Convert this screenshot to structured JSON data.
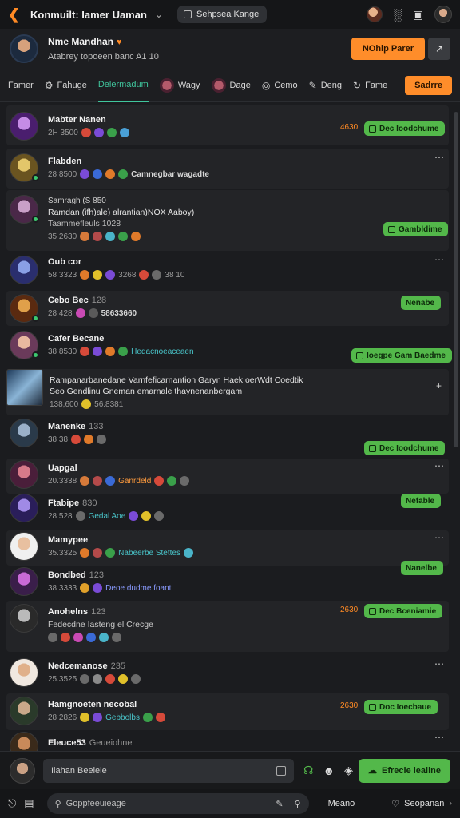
{
  "topbar": {
    "title": "Konmuilt: Iamer Uaman",
    "chevron": "chevron-down-icon",
    "workspace_pill": "Sehpsea Kange",
    "icons": [
      "user-avatar-mini",
      "stats-icon",
      "camera-icon",
      "profile-avatar"
    ]
  },
  "profile": {
    "name": "Nme Mandhan",
    "subtitle": "Atabrey topoeen banc  A1 10",
    "cta": "NOhip Parer",
    "ext_icon": "external-link-icon"
  },
  "tabs": [
    {
      "label": "Famer",
      "icon": ""
    },
    {
      "label": "Fahuge",
      "icon": "gear-icon"
    },
    {
      "label": "Delermadum",
      "icon": "",
      "active": true
    },
    {
      "label": "Wagy",
      "icon": "avatar"
    },
    {
      "label": "Dage",
      "icon": "avatar"
    },
    {
      "label": "Cemo",
      "icon": "compass-icon"
    },
    {
      "label": "Deng",
      "icon": "pen-icon"
    },
    {
      "label": "Fame",
      "icon": "refresh-icon"
    }
  ],
  "tabs_cta": "Sadrre",
  "feed": {
    "items": [
      {
        "name": "Mabter Nanen",
        "meta": "2H 3500",
        "tags": [],
        "price": "4630",
        "button": "Dec Ioodchume",
        "more": false
      },
      {
        "name": "Flabden",
        "meta": "28 8500",
        "tags": [
          "Camnegbar wagadte"
        ],
        "price": "",
        "button": "",
        "more": true
      },
      {
        "name": "Samragh (S 850",
        "line2": "Ramdan (ifh)ale) alrantian)NOX Aaboy)",
        "line3": "Taammefleuls 1028",
        "meta": "35 2630",
        "tags": [],
        "price": "",
        "button": "Gambldime",
        "more": false
      },
      {
        "name": "Oub cor",
        "meta": "58 3323",
        "tags": [
          "3268",
          "38  10"
        ],
        "price": "",
        "button": "",
        "more": true
      },
      {
        "name": "Cebo Bec",
        "muted": "128",
        "meta": "28 428",
        "tags": [
          "58633660"
        ],
        "price": "",
        "button": "Nenabe",
        "more": false
      },
      {
        "name": "Cafer Becane",
        "meta": "38 8530",
        "tags": [
          "Hedacnoeaceaen"
        ],
        "price": "",
        "button": "Ioegpe Gam Baedme",
        "more": false
      },
      {
        "name": "Rampanarbanedane Varnfeficarnantion Garyn Haek oerWdt Coedtik",
        "line2": "Seo Gendlinu Gneman emarnale thaynenanbergam",
        "meta": "138,600",
        "tags": [
          "56.8381"
        ],
        "price": "",
        "button": "",
        "more": false,
        "plus": true
      },
      {
        "name": "Manenke",
        "muted": "133",
        "meta": "38 38",
        "tags": [],
        "price": "",
        "button": "Dec Ioodchume",
        "more": false
      },
      {
        "name": "Uapgal",
        "meta": "20.3338",
        "tags": [
          "Ganrdeld"
        ],
        "price": "",
        "button": "",
        "more": true
      },
      {
        "name": "Ftabipe",
        "muted": "830",
        "meta": "28 528",
        "tags": [
          "Gedal Aoe"
        ],
        "price": "",
        "button": "Nefable",
        "more": false
      },
      {
        "name": "Mamypee",
        "meta": "35.3325",
        "tags": [
          "Nabeerbe Stettes"
        ],
        "price": "",
        "button": "",
        "more": true
      },
      {
        "name": "Bondbed",
        "muted": "123",
        "meta": "38 3333",
        "tags": [
          "Deoe dudme foanti"
        ],
        "price": "",
        "button": "Nanelbe",
        "more": false
      },
      {
        "name": "Anohelns",
        "muted": "123",
        "line2": "Fedecdne  Iasteng el Crecge",
        "meta": "",
        "tags": [],
        "price": "2630",
        "button": "Dec Bceniamie",
        "more": false
      },
      {
        "name": "Nedcemanose",
        "muted": "235",
        "meta": "25.3525",
        "tags": [],
        "price": "",
        "button": "",
        "more": true
      },
      {
        "name": "Hamgnoeten necobal",
        "meta": "28 2826",
        "tags": [
          "Gebbolbs"
        ],
        "price": "2630",
        "button": "Doc Ioecbaue",
        "more": false
      },
      {
        "name": "Eleuce53",
        "muted": "Geueiohne",
        "meta": "",
        "tags": [],
        "price": "",
        "button": "",
        "more": true
      }
    ]
  },
  "composer": {
    "placeholder": "Ilahan Beeiele",
    "send_label": "Efrecie lealine",
    "icons": [
      "attach-icon",
      "emoji-icon",
      "gamepad-icon"
    ]
  },
  "bottombar": {
    "search_placeholder": "Goppfeeuieage",
    "label_mid": "Meano",
    "label_right": "Seopanan"
  },
  "colors": {
    "accent_orange": "#ff8d2a",
    "accent_green": "#53b84a",
    "accent_teal": "#40c69d"
  }
}
